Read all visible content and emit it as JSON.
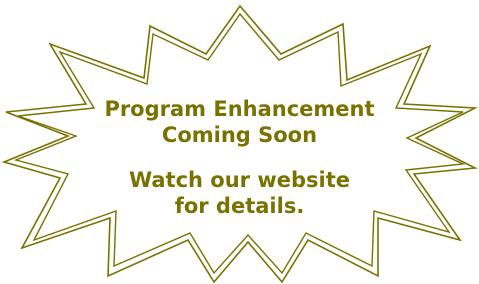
{
  "announcement": {
    "line1": "Program Enhancement",
    "line2": "Coming Soon",
    "line3": "Watch our website",
    "line4": "for details."
  },
  "colors": {
    "text": "#7a7200",
    "burst_outline": "#7a7200",
    "burst_fill": "#ffffff",
    "background": "#ffffff"
  }
}
